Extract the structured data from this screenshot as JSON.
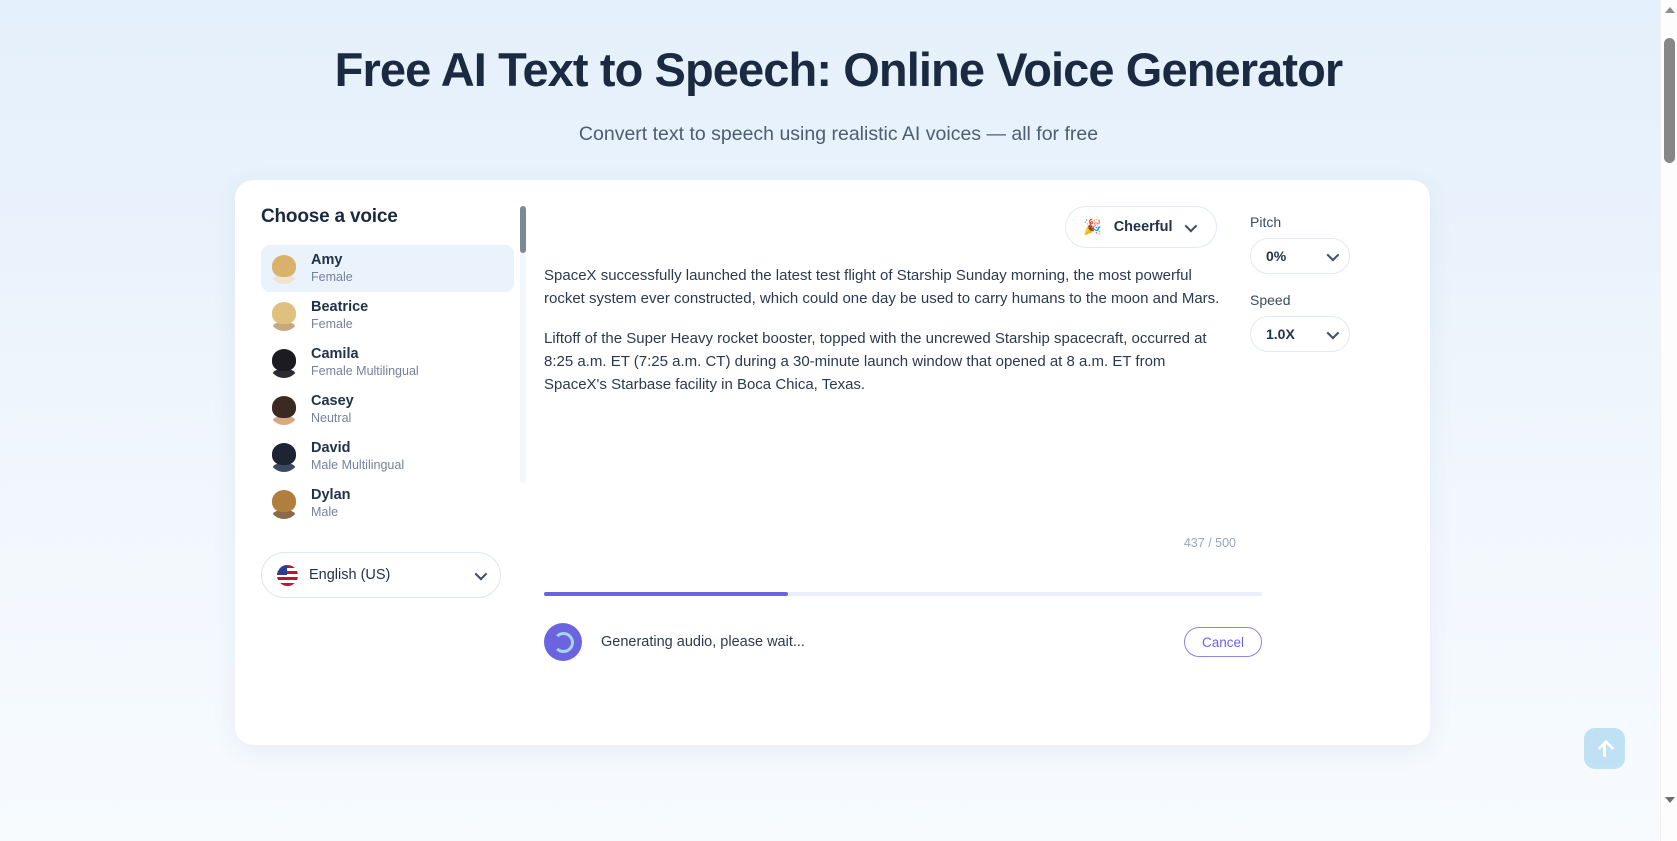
{
  "hero": {
    "title": "Free AI Text to Speech: Online Voice Generator",
    "subtitle": "Convert text to speech using realistic AI voices — all for free"
  },
  "voice_panel": {
    "heading": "Choose a voice",
    "voices": [
      {
        "name": "Amy",
        "gender": "Female",
        "selected": true,
        "hair": "#d8b26a",
        "body": "#f2e3cf"
      },
      {
        "name": "Beatrice",
        "gender": "Female",
        "selected": false,
        "hair": "#e0c07e",
        "body": "#c9a77e"
      },
      {
        "name": "Camila",
        "gender": "Female Multilingual",
        "selected": false,
        "hair": "#1c1b22",
        "body": "#2b2a33"
      },
      {
        "name": "Casey",
        "gender": "Neutral",
        "selected": false,
        "hair": "#3b2a22",
        "body": "#d9a87e"
      },
      {
        "name": "David",
        "gender": "Male Multilingual",
        "selected": false,
        "hair": "#1d2433",
        "body": "#3a4a60"
      },
      {
        "name": "Dylan",
        "gender": "Male",
        "selected": false,
        "hair": "#b07f3e",
        "body": "#8a6a4a"
      }
    ],
    "language": {
      "label": "English (US)",
      "flag_icon": "us-flag-icon"
    }
  },
  "editor": {
    "style_selector": {
      "label": "Cheerful",
      "emoji": "🎉"
    },
    "paragraphs": [
      "SpaceX successfully launched the latest test flight of Starship Sunday morning, the most powerful rocket system ever constructed, which could one day be used to carry humans to the moon and Mars.",
      "Liftoff of the Super Heavy rocket booster, topped with the uncrewed Starship spacecraft, occurred at 8:25 a.m. ET (7:25 a.m. CT) during a 30-minute launch window that opened at 8 a.m. ET from SpaceX's Starbase facility in Boca Chica, Texas."
    ],
    "char_count": "437 / 500",
    "progress_percent": 34,
    "status_text": "Generating audio, please wait...",
    "cancel_label": "Cancel"
  },
  "params": {
    "pitch_label": "Pitch",
    "pitch_value": "0%",
    "speed_label": "Speed",
    "speed_value": "1.0X"
  },
  "fab": {
    "name": "scroll-to-top-button"
  },
  "colors": {
    "accent": "#6c63e0",
    "page_bg_top": "#e4f0fb",
    "selected_row": "#eaf2fc",
    "text_dark": "#1b2a41"
  }
}
